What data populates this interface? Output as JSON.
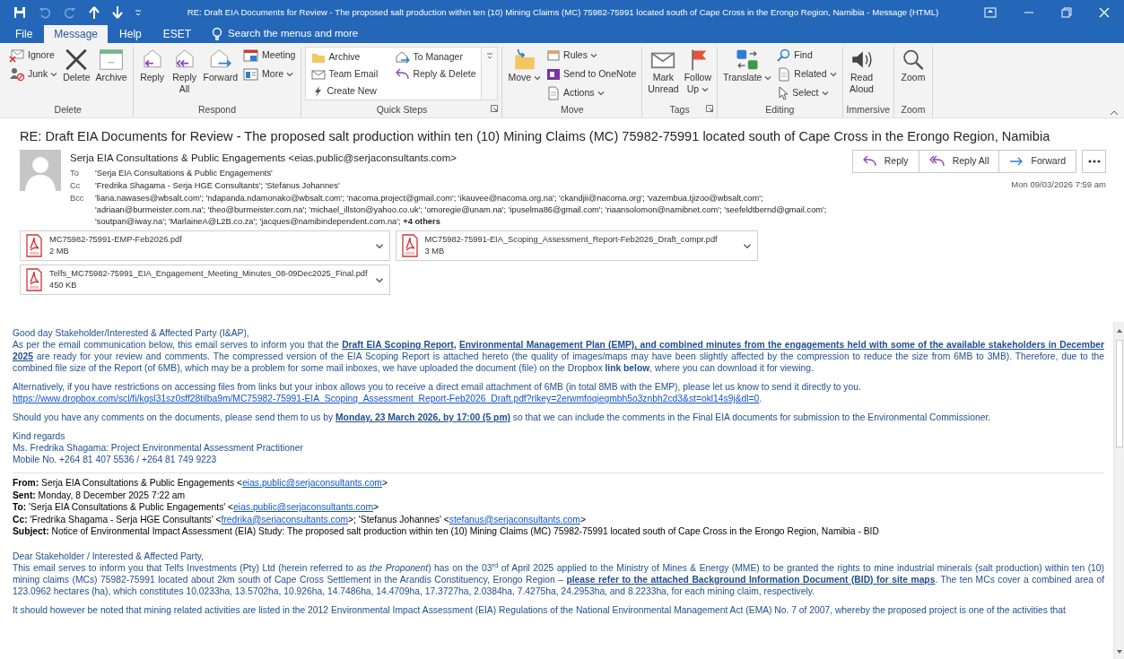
{
  "window": {
    "title": "RE: Draft EIA Documents for Review - The proposed salt production within ten (10) Mining Claims (MC) 75982-75991 located south of Cape Cross in the Erongo Region, Namibia  -  Message (HTML)"
  },
  "tabs": [
    {
      "label": "File",
      "selected": false
    },
    {
      "label": "Message",
      "selected": true
    },
    {
      "label": "Help",
      "selected": false
    },
    {
      "label": "ESET",
      "selected": false
    }
  ],
  "search": {
    "placeholder": "Search the menus and more"
  },
  "ribbon": {
    "groups": [
      {
        "label": "Delete",
        "launcher": false,
        "columns": [
          {
            "kind": "stack",
            "items": [
              {
                "label": "Ignore",
                "caret": false
              },
              {
                "label": "Junk",
                "caret": true
              }
            ]
          },
          {
            "kind": "large",
            "items": [
              {
                "label": "Delete",
                "caret": false
              }
            ]
          },
          {
            "kind": "large",
            "items": [
              {
                "label": "Archive",
                "caret": false
              }
            ]
          }
        ]
      },
      {
        "label": "Respond",
        "launcher": false,
        "columns": [
          {
            "kind": "large",
            "items": [
              {
                "label": "Reply",
                "caret": false
              }
            ]
          },
          {
            "kind": "large",
            "items": [
              {
                "label": "Reply\nAll",
                "caret": false
              }
            ]
          },
          {
            "kind": "large",
            "items": [
              {
                "label": "Forward",
                "caret": false
              }
            ]
          },
          {
            "kind": "stack",
            "items": [
              {
                "label": "Meeting",
                "caret": false
              },
              {
                "label": "More",
                "caret": true
              }
            ]
          }
        ]
      },
      {
        "label": "Quick Steps",
        "launcher": true,
        "columns": [
          {
            "kind": "gallery",
            "items": [
              {
                "label": "Archive",
                "caret": false
              },
              {
                "label": "Team Email",
                "caret": false
              },
              {
                "label": "Create New",
                "caret": false
              },
              {
                "label": "To Manager",
                "caret": false
              },
              {
                "label": "Reply & Delete",
                "caret": false
              }
            ]
          }
        ]
      },
      {
        "label": "Move",
        "launcher": false,
        "columns": [
          {
            "kind": "large",
            "items": [
              {
                "label": "Move",
                "caret": true
              }
            ]
          },
          {
            "kind": "stack",
            "items": [
              {
                "label": "Rules",
                "caret": true
              },
              {
                "label": "Send to OneNote",
                "caret": false
              },
              {
                "label": "Actions",
                "caret": true
              }
            ]
          }
        ]
      },
      {
        "label": "Tags",
        "launcher": true,
        "columns": [
          {
            "kind": "large",
            "items": [
              {
                "label": "Mark\nUnread",
                "caret": false
              }
            ]
          },
          {
            "kind": "large",
            "items": [
              {
                "label": "Follow\nUp",
                "caret": true
              }
            ]
          }
        ]
      },
      {
        "label": "Editing",
        "launcher": false,
        "columns": [
          {
            "kind": "large",
            "items": [
              {
                "label": "Translate",
                "caret": true
              }
            ]
          },
          {
            "kind": "stack",
            "items": [
              {
                "label": "Find",
                "caret": false
              },
              {
                "label": "Related",
                "caret": true
              },
              {
                "label": "Select",
                "caret": true
              }
            ]
          }
        ]
      },
      {
        "label": "Immersive",
        "launcher": false,
        "columns": [
          {
            "kind": "large",
            "items": [
              {
                "label": "Read\nAloud",
                "caret": false
              }
            ]
          }
        ]
      },
      {
        "label": "Zoom",
        "launcher": false,
        "columns": [
          {
            "kind": "large",
            "items": [
              {
                "label": "Zoom",
                "caret": false
              }
            ]
          }
        ]
      }
    ]
  },
  "message": {
    "subject": "RE: Draft EIA Documents for Review - The proposed salt production within ten (10) Mining Claims (MC) 75982-75991 located south of Cape Cross in the Erongo Region, Namibia",
    "sender": "Serja EIA Consultations & Public Engagements <eias.public@serjaconsultants.com>",
    "recipients": [
      {
        "label": "To",
        "value": "'Serja EIA Consultations & Public Engagements'"
      },
      {
        "label": "Cc",
        "value": "'Fredrika Shagama - Serja HGE Consultants'; 'Stefanus Johannes'"
      },
      {
        "label": "Bcc",
        "value": "'liana.nawases@wbsalt.com'; 'ndapanda.ndamonako@wbsalt.com'; 'nacoma.project@gmail.com'; 'ikauvee@nacoma.org.na'; 'ckandjii@nacoma.org'; 'vazembua.tjizoo@wbsalt.com'; 'adriaan@burmeister.com.na'; 'theo@burmeister.com.na'; 'michael_illston@yahoo.co.uk'; 'omoregie@unam.na'; 'ipuselma86@gmail.com'; 'riaansolomon@namibnet.com'; 'seefeldtbernd@gmail.com'; 'soutpan@iway.na'; 'MarlaineA@L2B.co.za'; 'jacques@namibindependent.com.na'; **+4 others**"
      }
    ],
    "actions": [
      "Reply",
      "Reply All",
      "Forward"
    ],
    "date": "Mon 09/03/2026 7:59 am",
    "attachments": [
      {
        "name": "MC75982-75991-EMP-Feb2026.pdf",
        "size": "2 MB"
      },
      {
        "name": "MC75982-75991-EIA_Scoping_Assessment_Report-Feb2026_Draft_compr.pdf",
        "size": "3 MB"
      },
      {
        "name": "Telfs_MC75982-75991_EIA_Engagement_Meeting_Minutes_08-09Dec2025_Final.pdf",
        "size": "450 KB"
      }
    ]
  },
  "reply_body": [
    {
      "lines": [
        {
          "runs": [
            {
              "text": "Good day Stakeholder/Interested & Affected Party (I&AP),",
              "kind": "plain"
            }
          ]
        },
        {
          "runs": [
            {
              "text": "As per the email communication below, this email serves to inform you that the ",
              "kind": "plain"
            },
            {
              "text": "Draft EIA Scoping Report",
              "kind": "bold_underline"
            },
            {
              "text": ", ",
              "kind": "bold"
            },
            {
              "text": "Environmental Management Plan (EMP), and combined minutes from the engagements held with some of the available stakeholders in December 2025",
              "kind": "bold_underline"
            },
            {
              "text": " are ready for your review and comments. The compressed version of the EIA Scoping Report is attached hereto (the quality of images/maps may have been slightly affected by the compression to reduce the size from 6MB to 3MB). Therefore, due to the combined file size of the Report (of 6MB), which may be a problem for some mail inboxes, we have uploaded the document (file) on the Dropbox ",
              "kind": "plain"
            },
            {
              "text": "link below",
              "kind": "bold"
            },
            {
              "text": ", where you can download it for viewing.",
              "kind": "plain"
            }
          ]
        }
      ]
    },
    {
      "lines": [
        {
          "runs": [
            {
              "text": "Alternatively, if you have restrictions on accessing files from links but your inbox allows you to receive a direct email attachment of 6MB (in total 8MB with the EMP), please let us know to send it directly to you.",
              "kind": "plain"
            }
          ]
        },
        {
          "runs": [
            {
              "text": "https://www.dropbox.com/scl/fi/kgsl31sz0sff28tilba9m/MC75982-75991-EIA_Scoping_Assessment_Report-Feb2026_Draft.pdf?rlkey=2erwmfoqiegmbh5o3znbh2cd3&st=okl14s9j&dl=0",
              "kind": "link"
            },
            {
              "text": ".",
              "kind": "plain"
            }
          ]
        }
      ]
    },
    {
      "lines": [
        {
          "runs": [
            {
              "text": "Should you have any comments on the documents, please send them to us by ",
              "kind": "plain"
            },
            {
              "text": "Monday, 23 March 2026, by 17:00 (5 pm)",
              "kind": "bold_underline"
            },
            {
              "text": " so that we can include the comments in the Final EIA documents for submission to the Environmental Commissioner.",
              "kind": "plain"
            }
          ]
        }
      ]
    },
    {
      "lines": [
        {
          "runs": [
            {
              "text": "Kind regards",
              "kind": "plain"
            }
          ]
        },
        {
          "runs": [
            {
              "text": "Ms. Fredrika Shagama: Project Environmental Assessment Practitioner",
              "kind": "plain"
            }
          ]
        },
        {
          "runs": [
            {
              "text": "Mobile No. +264 81 407 5536 / +264 81 749 9223",
              "kind": "plain"
            }
          ]
        }
      ]
    }
  ],
  "forward_header": [
    {
      "label": "From:",
      "runs": [
        {
          "text": " Serja EIA Consultations & Public Engagements <",
          "kind": "plain"
        },
        {
          "text": "eias.public@serjaconsultants.com",
          "kind": "link"
        },
        {
          "text": ">",
          "kind": "plain"
        }
      ]
    },
    {
      "label": "Sent:",
      "runs": [
        {
          "text": " Monday, 8 December 2025 7:22 am",
          "kind": "plain"
        }
      ]
    },
    {
      "label": "To:",
      "runs": [
        {
          "text": " 'Serja EIA Consultations & Public Engagements' <",
          "kind": "plain"
        },
        {
          "text": "eias.public@serjaconsultants.com",
          "kind": "link"
        },
        {
          "text": ">",
          "kind": "plain"
        }
      ]
    },
    {
      "label": "Cc:",
      "runs": [
        {
          "text": " 'Fredrika Shagama - Serja HGE Consultants' <",
          "kind": "plain"
        },
        {
          "text": "fredrika@serjaconsultants.com",
          "kind": "link"
        },
        {
          "text": ">; 'Stefanus Johannes' <",
          "kind": "plain"
        },
        {
          "text": "stefanus@serjaconsultants.com",
          "kind": "link"
        },
        {
          "text": ">",
          "kind": "plain"
        }
      ]
    },
    {
      "label": "Subject:",
      "runs": [
        {
          "text": " Notice of Environmental Impact Assessment (EIA) Study: The proposed salt production within ten (10) Mining Claims (MC) 75982-75991 located south of Cape Cross in the Erongo Region, Namibia - BID",
          "kind": "plain"
        }
      ]
    }
  ],
  "original_body": [
    {
      "lines": [
        {
          "runs": [
            {
              "text": "Dear Stakeholder / Interested & Affected Party,",
              "kind": "plain"
            }
          ]
        },
        {
          "runs": [
            {
              "text": "This email serves to inform you that Telfs Investments (Pty) Ltd (herein referred to as ",
              "kind": "plain"
            },
            {
              "text": "the Proponent",
              "kind": "italic"
            },
            {
              "text": ") has on the 03",
              "kind": "plain"
            },
            {
              "text": "rd",
              "kind": "sup"
            },
            {
              "text": " of April 2025 applied to the Ministry of Mines & Energy (MME) to be granted the rights to mine industrial minerals (salt production) within ten (10) mining claims (MCs) 75982-75991 located about 2km south of Cape Cross Settlement in the Arandis Constituency, Erongo Region – ",
              "kind": "plain"
            },
            {
              "text": "please refer to the attached Background Information Document (BID) for site maps",
              "kind": "bold_underline"
            },
            {
              "text": ". The ten MCs cover a combined area of 123.0962 hectares (ha), which constitutes 10.0233ha, 13.5702ha, 10.926ha, 14.7486ha, 14.4709ha, 17.3727ha, 2.0384ha, 7.4275ha, 24.2953ha, and 8.2233ha, for each mining claim, respectively.",
              "kind": "plain"
            }
          ]
        }
      ]
    },
    {
      "lines": [
        {
          "runs": [
            {
              "text": "It should however be noted that mining related activities are listed in the 2012 Environmental Impact Assessment (EIA) Regulations of the National Environmental Management Act (EMA) No. 7 of 2007, whereby the proposed project is one of the activities that",
              "kind": "plain"
            }
          ]
        }
      ]
    }
  ]
}
